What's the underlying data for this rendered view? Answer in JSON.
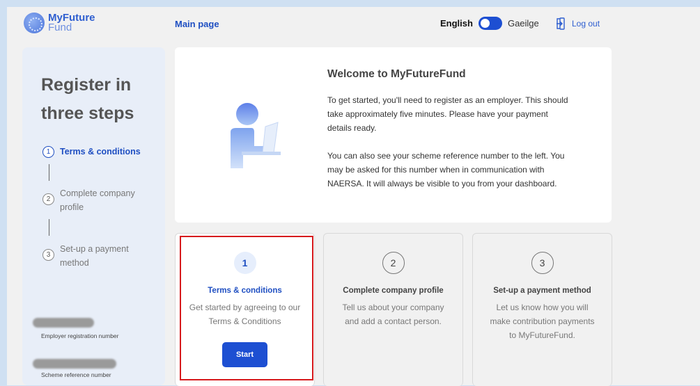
{
  "header": {
    "logo_line1": "MyFuture",
    "logo_line2": "Fund",
    "main_link": "Main page",
    "lang_en": "English",
    "lang_ga": "Gaeilge",
    "logout": "Log out"
  },
  "sidebar": {
    "title": "Register in three steps",
    "steps": [
      {
        "num": "1",
        "label": "Terms & conditions"
      },
      {
        "num": "2",
        "label": "Complete company profile"
      },
      {
        "num": "3",
        "label": "Set-up a payment method"
      }
    ],
    "employer_reg_label": "Employer registration number",
    "scheme_ref_label": "Scheme reference number"
  },
  "welcome": {
    "title": "Welcome to MyFutureFund",
    "para1": "To get started, you'll need to register as an employer. This should take approximately five minutes. Please have your payment details ready.",
    "para2": "You can also see your scheme reference number to the left. You may be asked for this number when in communication with NAERSA. It will always be visible to you from your dashboard."
  },
  "cards": [
    {
      "num": "1",
      "title": "Terms & conditions",
      "desc": "Get started by agreeing to our Terms & Conditions",
      "button": "Start"
    },
    {
      "num": "2",
      "title": "Complete company profile",
      "desc": "Tell us about your company and add a contact person."
    },
    {
      "num": "3",
      "title": "Set-up a payment method",
      "desc": "Let us know how you will make contribution payments to MyFutureFund."
    }
  ],
  "colors": {
    "accent": "#1d4fd2",
    "highlight": "#d6191c"
  }
}
